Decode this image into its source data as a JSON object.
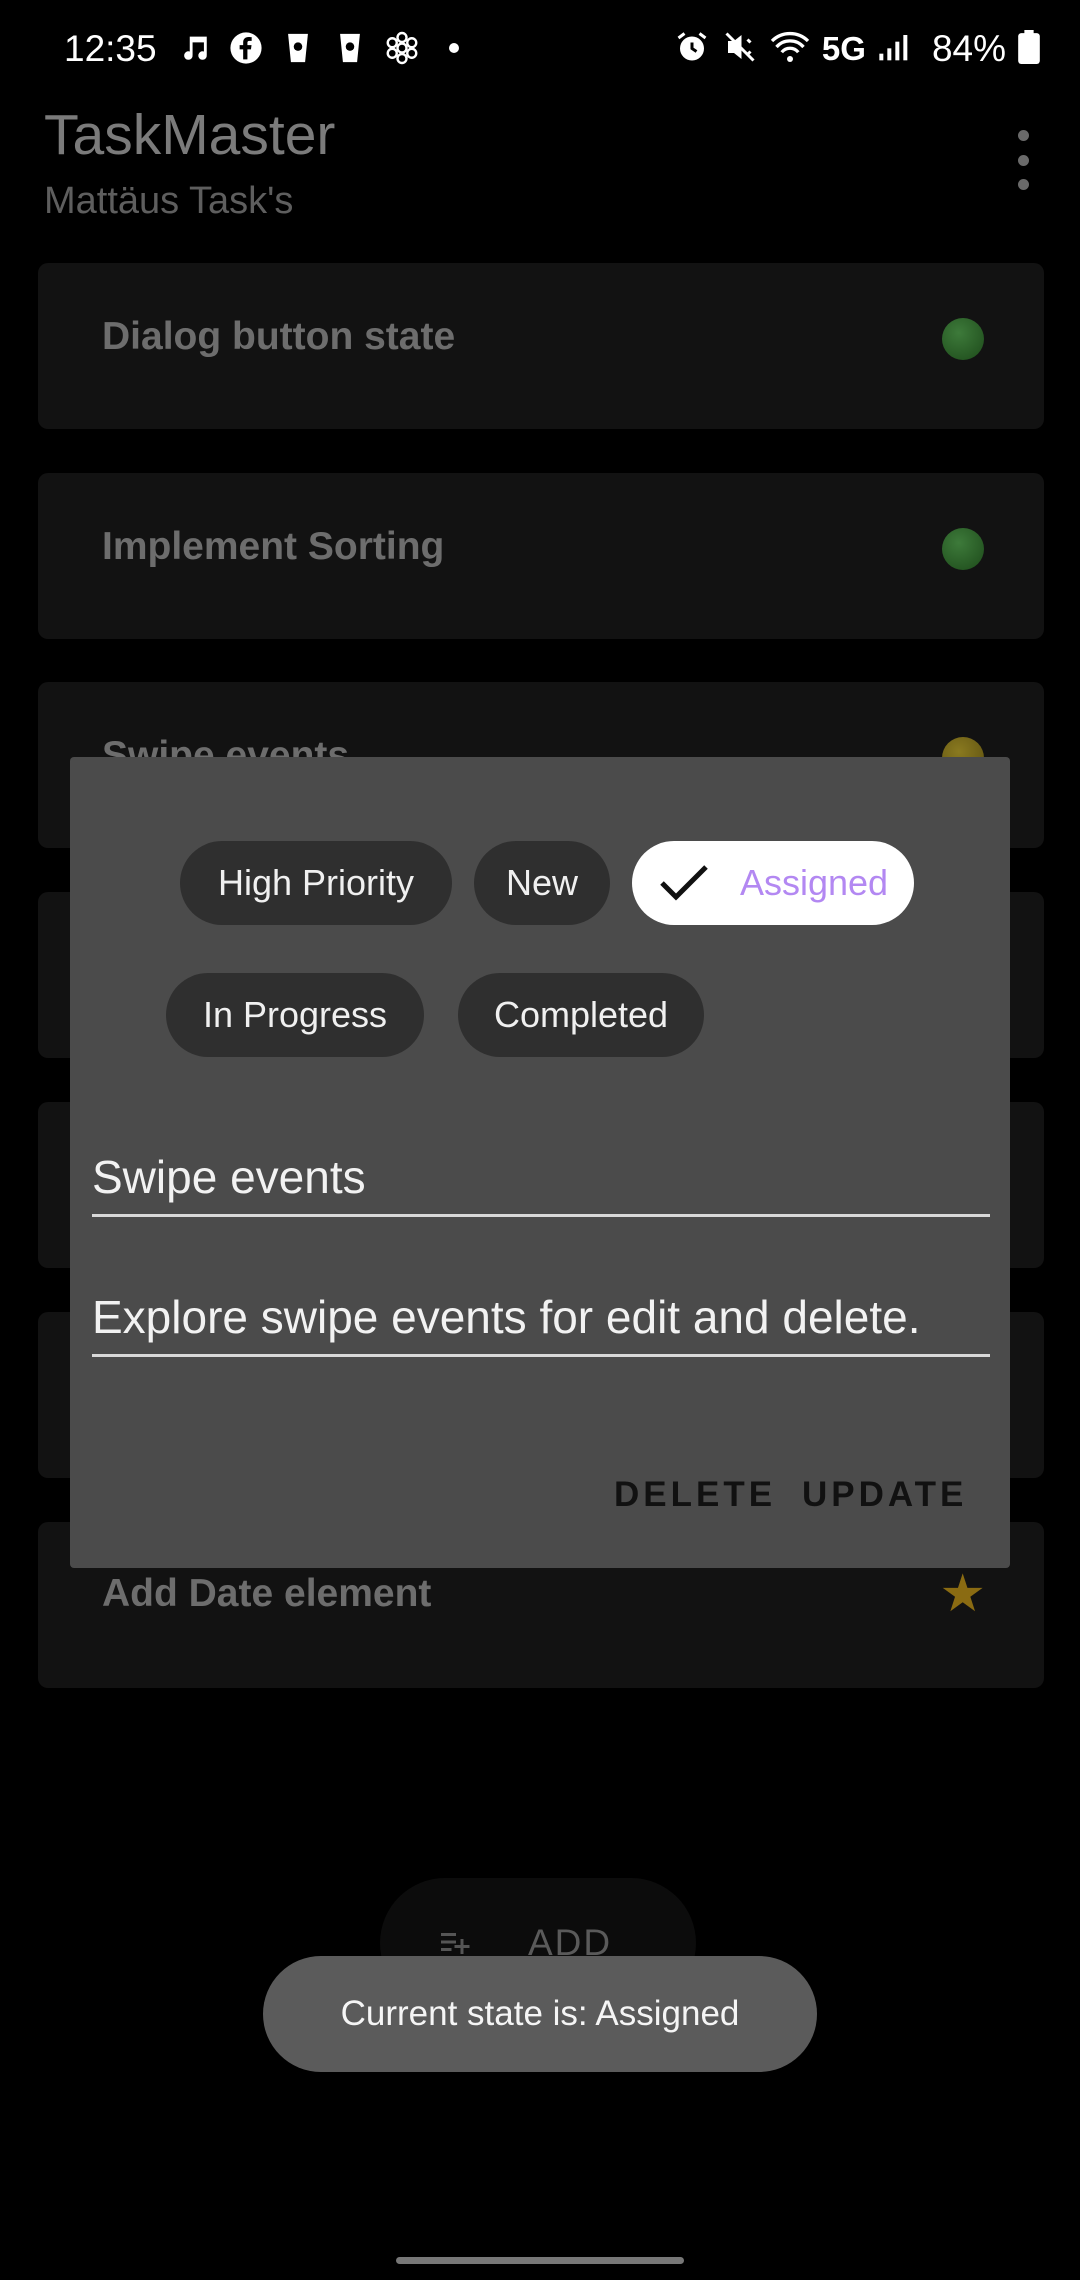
{
  "status_bar": {
    "time": "12:35",
    "network": "5G",
    "battery": "84%",
    "left_icons": [
      "music-note-icon",
      "facebook-icon",
      "cup-icon",
      "cup-icon",
      "snowflake-icon",
      "dot-icon"
    ],
    "right_icons": [
      "alarm-icon",
      "vibrate-mute-icon",
      "wifi-icon",
      "signal-icon",
      "battery-icon"
    ]
  },
  "app": {
    "title": "TaskMaster",
    "subtitle": "Mattäus Task's"
  },
  "tasks": [
    {
      "title": "Dialog button state",
      "indicator": "green"
    },
    {
      "title": "Implement Sorting",
      "indicator": "green"
    },
    {
      "title": "Swipe events",
      "indicator": "yellow"
    },
    {
      "title": "Add Date element",
      "indicator": "star"
    }
  ],
  "colors": {
    "accent_purple": "#b388f2",
    "dialog_bg": "#4b4b4b",
    "chip_bg": "#2f2f2f",
    "toast_bg": "#5b5b5b",
    "indicator_green": "#2e6a2b",
    "indicator_yellow": "#7a6a18",
    "indicator_star": "#8a6b12"
  },
  "dialog": {
    "chips": [
      {
        "label": "High Priority",
        "selected": false
      },
      {
        "label": "New",
        "selected": false
      },
      {
        "label": "Assigned",
        "selected": true
      },
      {
        "label": "In Progress",
        "selected": false
      },
      {
        "label": "Completed",
        "selected": false
      }
    ],
    "title_value": "Swipe events",
    "description_value": "Explore swipe events for edit and delete.",
    "delete_label": "DELETE",
    "update_label": "UPDATE"
  },
  "fab": {
    "label": "ADD",
    "icon": "add-list-icon"
  },
  "toast": {
    "message": "Current state is: Assigned"
  }
}
